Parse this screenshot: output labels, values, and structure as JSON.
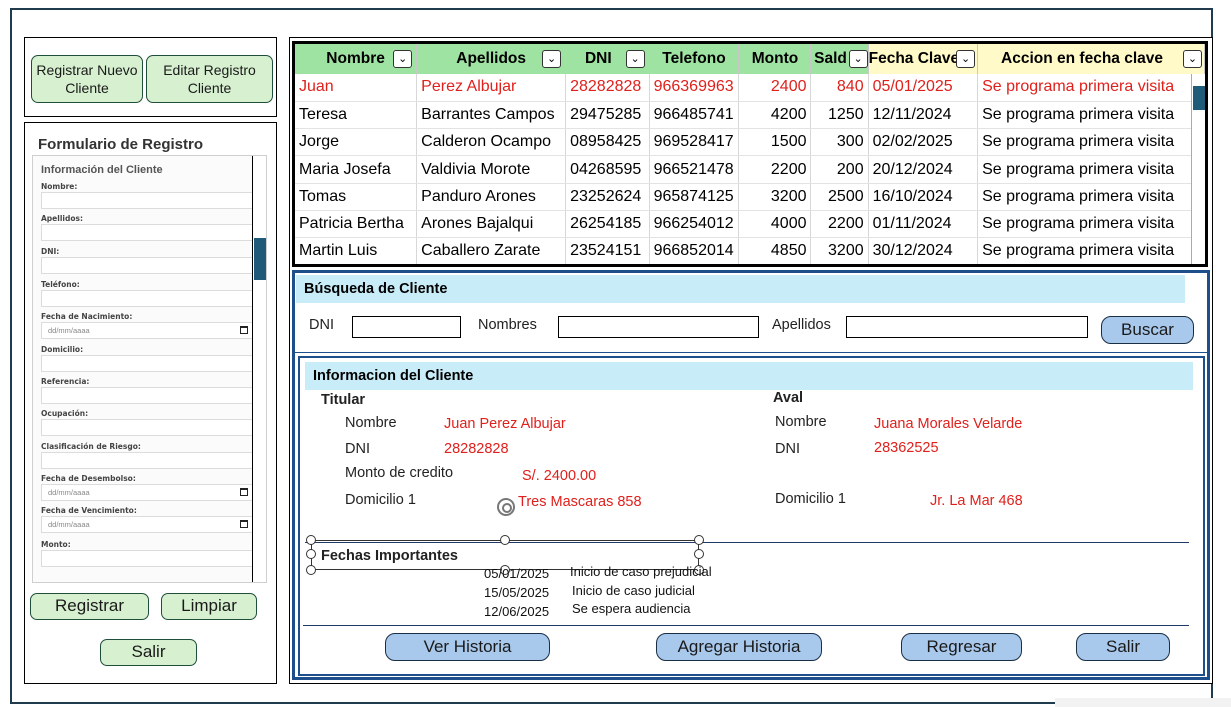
{
  "left": {
    "register_new": "Registrar Nuevo Cliente",
    "edit_record": "Editar Registro Cliente",
    "form_title": "Formulario de Registro",
    "form_section": "Información del Cliente",
    "fields": {
      "nombre": "Nombre:",
      "apellidos": "Apellidos:",
      "dni": "DNI:",
      "telefono": "Teléfono:",
      "fecha_nacimiento": "Fecha de Nacimiento:",
      "domicilio": "Domicilio:",
      "referencia": "Referencia:",
      "ocupacion": "Ocupación:",
      "clasificacion": "Clasificación de Riesgo:",
      "fecha_desembolso": "Fecha de Desembolso:",
      "fecha_vencimiento": "Fecha de Vencimiento:",
      "monto": "Monto:"
    },
    "date_placeholder": "dd/mm/aaaa",
    "btn_registrar": "Registrar",
    "btn_limpiar": "Limpiar",
    "btn_salir": "Salir"
  },
  "grid": {
    "headers": [
      "Nombre",
      "Apellidos",
      "DNI",
      "Telefono",
      "Monto",
      "Sald",
      "Fecha Clave",
      "Accion en fecha clave"
    ],
    "dropdown_icon": "chevron-down-icon",
    "rows": [
      [
        "Juan",
        "Perez Albujar",
        "28282828",
        "966369963",
        "2400",
        "840",
        "05/01/2025",
        "Se programa primera visita"
      ],
      [
        "Teresa",
        "Barrantes Campos",
        "29475285",
        "966485741",
        "4200",
        "1250",
        "12/11/2024",
        "Se programa primera visita"
      ],
      [
        "Jorge",
        "Calderon Ocampo",
        "08958425",
        "969528417",
        "1500",
        "300",
        "02/02/2025",
        "Se programa primera visita"
      ],
      [
        "Maria Josefa",
        "Valdivia Morote",
        "04268595",
        "966521478",
        "2200",
        "200",
        "20/12/2024",
        "Se programa primera visita"
      ],
      [
        "Tomas",
        "Panduro Arones",
        "23252624",
        "965874125",
        "3200",
        "2500",
        "16/10/2024",
        "Se programa primera visita"
      ],
      [
        "Patricia Bertha",
        "Arones Bajalqui",
        "26254185",
        "966254012",
        "4000",
        "2200",
        "01/11/2024",
        "Se programa primera visita"
      ],
      [
        "Martin Luis",
        "Caballero Zarate",
        "23524151",
        "966852014",
        "4850",
        "3200",
        "30/12/2024",
        "Se programa primera visita"
      ]
    ]
  },
  "search": {
    "title": "Búsqueda de Cliente",
    "dni_label": "DNI",
    "nombres_label": "Nombres",
    "apellidos_label": "Apellidos",
    "btn_buscar": "Buscar"
  },
  "info": {
    "title": "Informacion del Cliente",
    "titular": "Titular",
    "aval": "Aval",
    "nombre_label": "Nombre",
    "dni_label": "DNI",
    "monto_label": "Monto de credito",
    "domicilio_label": "Domicilio 1",
    "titular_nombre": "Juan Perez Albujar",
    "titular_dni": "28282828",
    "titular_monto": "S/. 2400.00",
    "titular_domicilio": "Tres Mascaras 858",
    "aval_nombre": "Juana Morales Velarde",
    "aval_dni": "28362525",
    "aval_domicilio": "Jr. La Mar 468",
    "fechas_title": "Fechas Importantes",
    "fechas": [
      {
        "date": "05/01/2025",
        "desc": "Inicio de caso prejudicial"
      },
      {
        "date": "15/05/2025",
        "desc": "Inicio de caso judicial"
      },
      {
        "date": "12/06/2025",
        "desc": "Se espera audiencia"
      }
    ],
    "btn_ver_historia": "Ver Historia",
    "btn_agregar_historia": "Agregar Historia",
    "btn_regresar": "Regresar",
    "btn_salir": "Salir"
  },
  "colors": {
    "header_green": "#9fe3a2",
    "header_yellow": "#fffac8",
    "button_blue": "#a8c8ec",
    "button_green": "#d6f0d0",
    "highlight_red": "#e0201c",
    "section_blue": "#c8ecf8"
  }
}
